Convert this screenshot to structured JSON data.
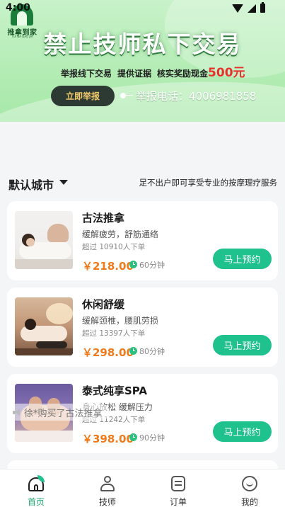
{
  "status_bar": {
    "time": "4:00"
  },
  "banner": {
    "logo_text": "推拿到家",
    "logo_subtext": "TUI NA DAO JIA",
    "headline": "禁止技师私下交易",
    "subline_items": [
      "举报线下交易",
      "提供证据",
      "核实奖励现金"
    ],
    "reward_amount": "500元",
    "report_button": "立即举报",
    "hotline": "举报电话：4006981858"
  },
  "city_bar": {
    "city": "默认城市",
    "slogan": "足不出户即可享受专业的按摩理疗服务"
  },
  "services": [
    {
      "title": "古法推拿",
      "desc": "缓解疲劳，舒筋通络",
      "sold": "超过 10910人下单",
      "price": "￥218.00",
      "duration": "60分钟",
      "button": "马上预约"
    },
    {
      "title": "休闲舒缓",
      "desc": "缓解颈椎，腰肌劳损",
      "sold": "超过 13397人下单",
      "price": "￥298.00",
      "duration": "80分钟",
      "button": "马上预约"
    },
    {
      "title": "泰式纯享SPA",
      "desc": "身心放松 缓解压力",
      "sold": "超过 11242人下单",
      "price": "￥398.00",
      "duration": "90分钟",
      "button": "马上预约"
    }
  ],
  "toast": {
    "text": "徐*购买了古法推拿"
  },
  "tabbar": {
    "items": [
      {
        "label": "首页",
        "icon": "home-icon",
        "active": true
      },
      {
        "label": "技师",
        "icon": "technician-icon",
        "active": false
      },
      {
        "label": "订单",
        "icon": "order-icon",
        "active": false
      },
      {
        "label": "我的",
        "icon": "profile-icon",
        "active": false
      }
    ]
  },
  "colors": {
    "accent_green": "#1fc18c",
    "price_orange": "#f07a1a",
    "reward_red": "#e5322c"
  }
}
